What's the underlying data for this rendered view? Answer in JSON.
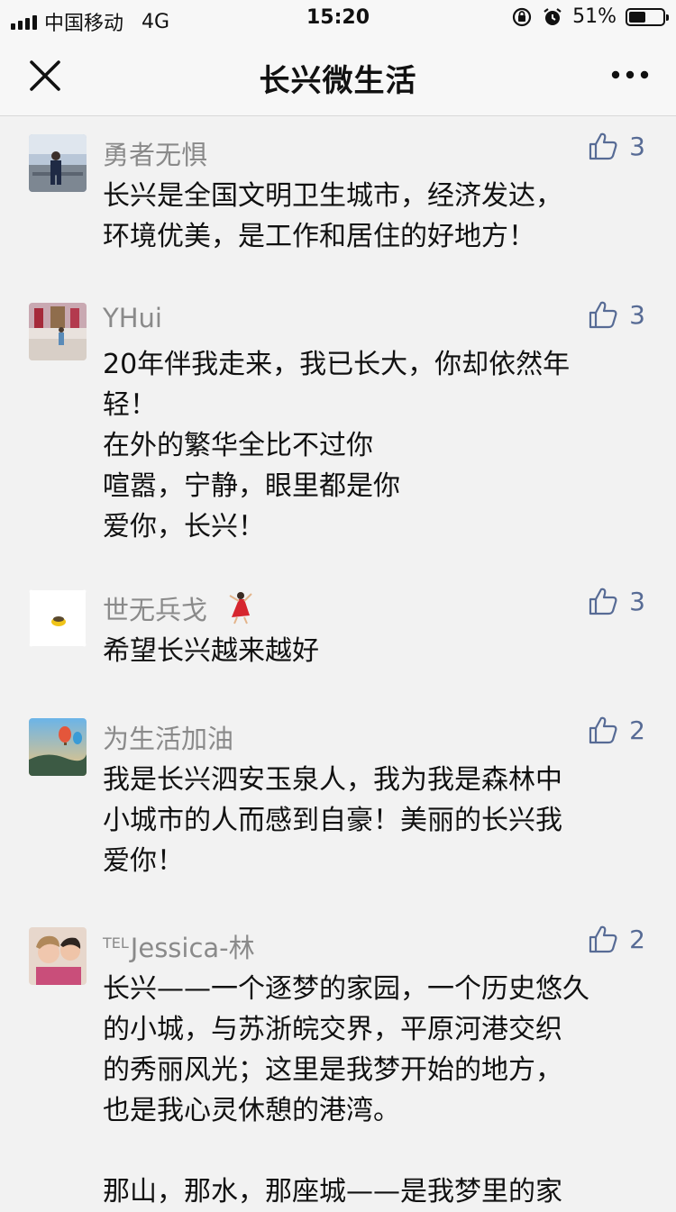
{
  "status_bar": {
    "carrier": "中国移动",
    "network": "4G",
    "time": "15:20",
    "battery": "51%",
    "battery_level": 0.51
  },
  "nav": {
    "title": "长兴微生活",
    "close_icon": "close-icon",
    "more_icon": "more-icon"
  },
  "colors": {
    "like": "#576b95",
    "author": "#8a8a8a"
  },
  "comments": [
    {
      "author": "勇者无惧",
      "likes": "3",
      "lines": [
        "长兴是全国文明卫生城市，经济发达，",
        "环境优美，是工作和居住的好地方！"
      ]
    },
    {
      "author": "YHui",
      "likes": "3",
      "lines": [
        "20年伴我走来，我已长大，你却依然年",
        "轻！",
        "在外的繁华全比不过你",
        "喧嚣，宁静，眼里都是你",
        "爱你，长兴！"
      ]
    },
    {
      "author": "世无兵戈",
      "likes": "3",
      "lines": [
        "希望长兴越来越好"
      ]
    },
    {
      "author": "为生活加油",
      "likes": "2",
      "lines": [
        "我是长兴泗安玉泉人，我为我是森林中",
        "小城市的人而感到自豪！美丽的长兴我",
        "爱你！"
      ]
    },
    {
      "author_prefix": "TEL",
      "author": "Jessica-林",
      "likes": "2",
      "lines": [
        "长兴——一个逐梦的家园，一个历史悠久",
        "的小城，与苏浙皖交界，平原河港交织",
        "的秀丽风光；这里是我梦开始的地方，",
        "也是我心灵休憩的港湾。",
        "",
        "那山，那水，那座城——是我梦里的家"
      ]
    }
  ]
}
